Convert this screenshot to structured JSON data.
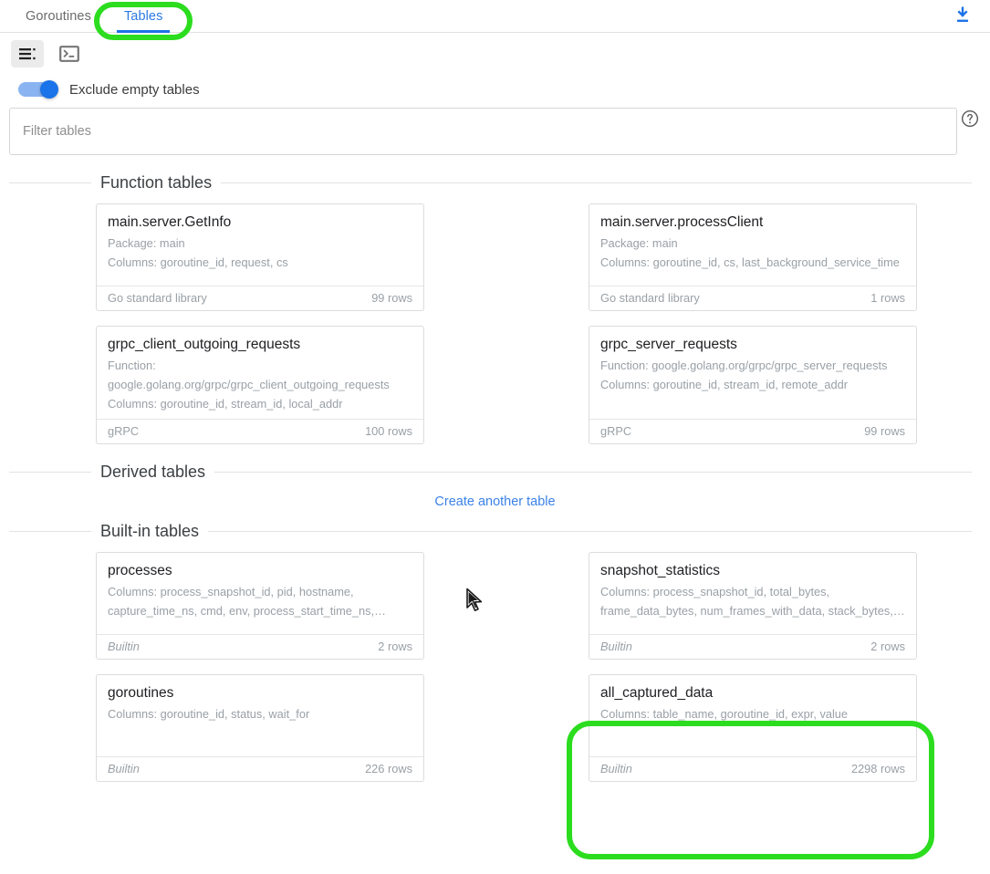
{
  "tabs": [
    {
      "label": "Goroutines",
      "active": false
    },
    {
      "label": "Tables",
      "active": true
    }
  ],
  "header": {
    "download_icon": "download-icon"
  },
  "toolbar": {
    "list_view_icon": "list-view-icon",
    "console_icon": "terminal-console-icon"
  },
  "options": {
    "exclude_empty_tables_label": "Exclude empty tables",
    "exclude_empty_tables_on": true
  },
  "filter": {
    "placeholder": "Filter tables",
    "value": "",
    "help_icon": "help-circle-icon"
  },
  "sections": [
    {
      "id": "function-tables",
      "title": "Function tables",
      "cards": [
        {
          "title": "main.server.GetInfo",
          "meta": [
            "Package: main",
            "Columns: goroutine_id, request, cs"
          ],
          "source": "Go standard library",
          "source_italic": false,
          "rows": "99 rows"
        },
        {
          "title": "main.server.processClient",
          "meta": [
            "Package: main",
            "Columns: goroutine_id, cs, last_background_service_time"
          ],
          "source": "Go standard library",
          "source_italic": false,
          "rows": "1 rows"
        },
        {
          "title": "grpc_client_outgoing_requests",
          "meta": [
            "Function: google.golang.org/grpc/grpc_client_outgoing_requests",
            "Columns: goroutine_id, stream_id, local_addr"
          ],
          "source": "gRPC",
          "source_italic": false,
          "rows": "100 rows"
        },
        {
          "title": "grpc_server_requests",
          "meta": [
            "Function: google.golang.org/grpc/grpc_server_requests",
            "Columns: goroutine_id, stream_id, remote_addr"
          ],
          "source": "gRPC",
          "source_italic": false,
          "rows": "99 rows"
        }
      ]
    },
    {
      "id": "derived-tables",
      "title": "Derived tables",
      "create_link": "Create another table",
      "cards": []
    },
    {
      "id": "builtin-tables",
      "title": "Built-in tables",
      "cards": [
        {
          "title": "processes",
          "meta": [
            "Columns: process_snapshot_id, pid, hostname, capture_time_ns, cmd, env, process_start_time_ns,…"
          ],
          "source": "Builtin",
          "source_italic": true,
          "rows": "2 rows"
        },
        {
          "title": "snapshot_statistics",
          "meta": [
            "Columns: process_snapshot_id, total_bytes, frame_data_bytes, num_frames_with_data, stack_bytes,…"
          ],
          "source": "Builtin",
          "source_italic": true,
          "rows": "2 rows"
        },
        {
          "title": "goroutines",
          "meta": [
            "Columns: goroutine_id, status, wait_for"
          ],
          "source": "Builtin",
          "source_italic": true,
          "rows": "226 rows"
        },
        {
          "title": "all_captured_data",
          "meta": [
            "Columns: table_name, goroutine_id, expr, value"
          ],
          "source": "Builtin",
          "source_italic": true,
          "rows": "2298 rows"
        }
      ]
    }
  ],
  "colors": {
    "accent_blue": "#1a73e8",
    "link_blue": "#3b82e8",
    "annotation_green": "#2bdd1e",
    "muted_gray": "#9aa0a6"
  }
}
